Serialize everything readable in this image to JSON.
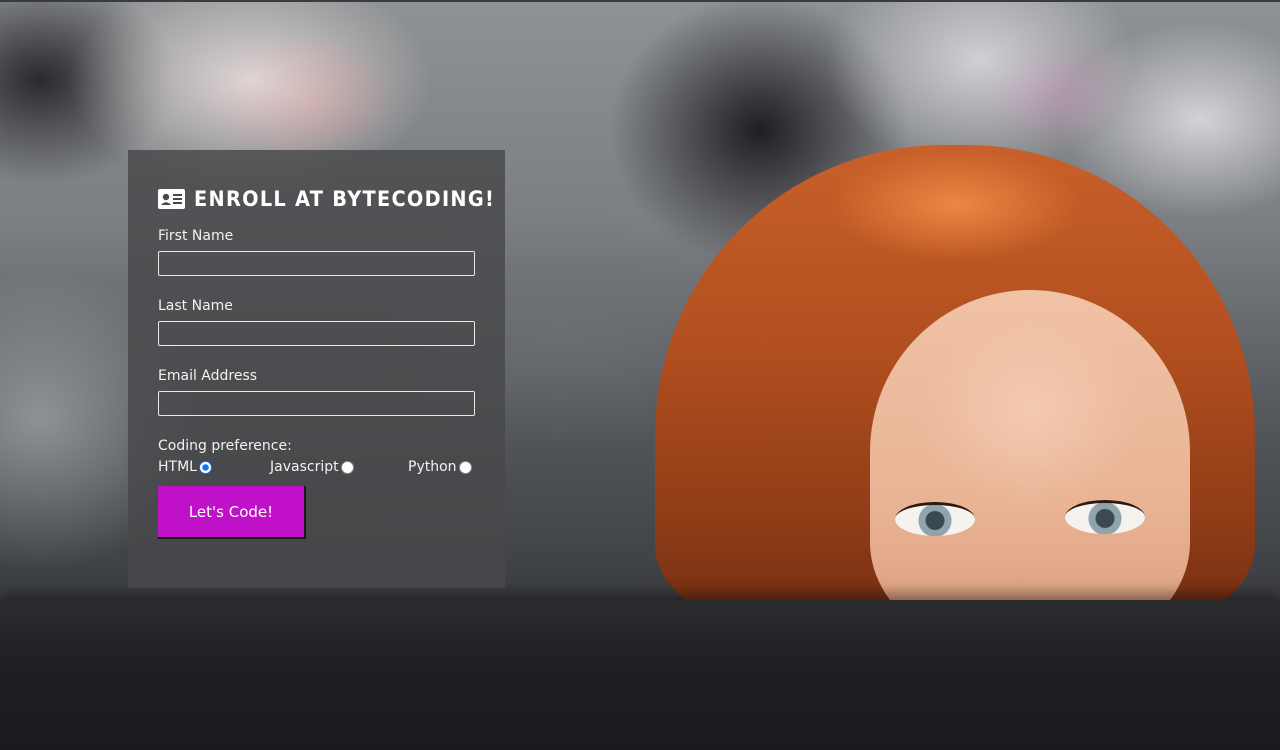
{
  "form": {
    "title": "ENROLL AT BYTECODING!",
    "title_icon": "id-card-icon",
    "fields": [
      {
        "label": "First Name",
        "value": "",
        "placeholder": ""
      },
      {
        "label": "Last Name",
        "value": "",
        "placeholder": ""
      },
      {
        "label": "Email Address",
        "value": "",
        "placeholder": ""
      }
    ],
    "preference": {
      "label": "Coding preference:",
      "options": [
        {
          "label": "HTML",
          "checked": true
        },
        {
          "label": "Javascript",
          "checked": false
        },
        {
          "label": "Python",
          "checked": false
        }
      ]
    },
    "submit_label": "Let's Code!"
  },
  "colors": {
    "accent": "#c111c8",
    "panel": "#48484a",
    "radio_checked": "#1a73e8"
  }
}
